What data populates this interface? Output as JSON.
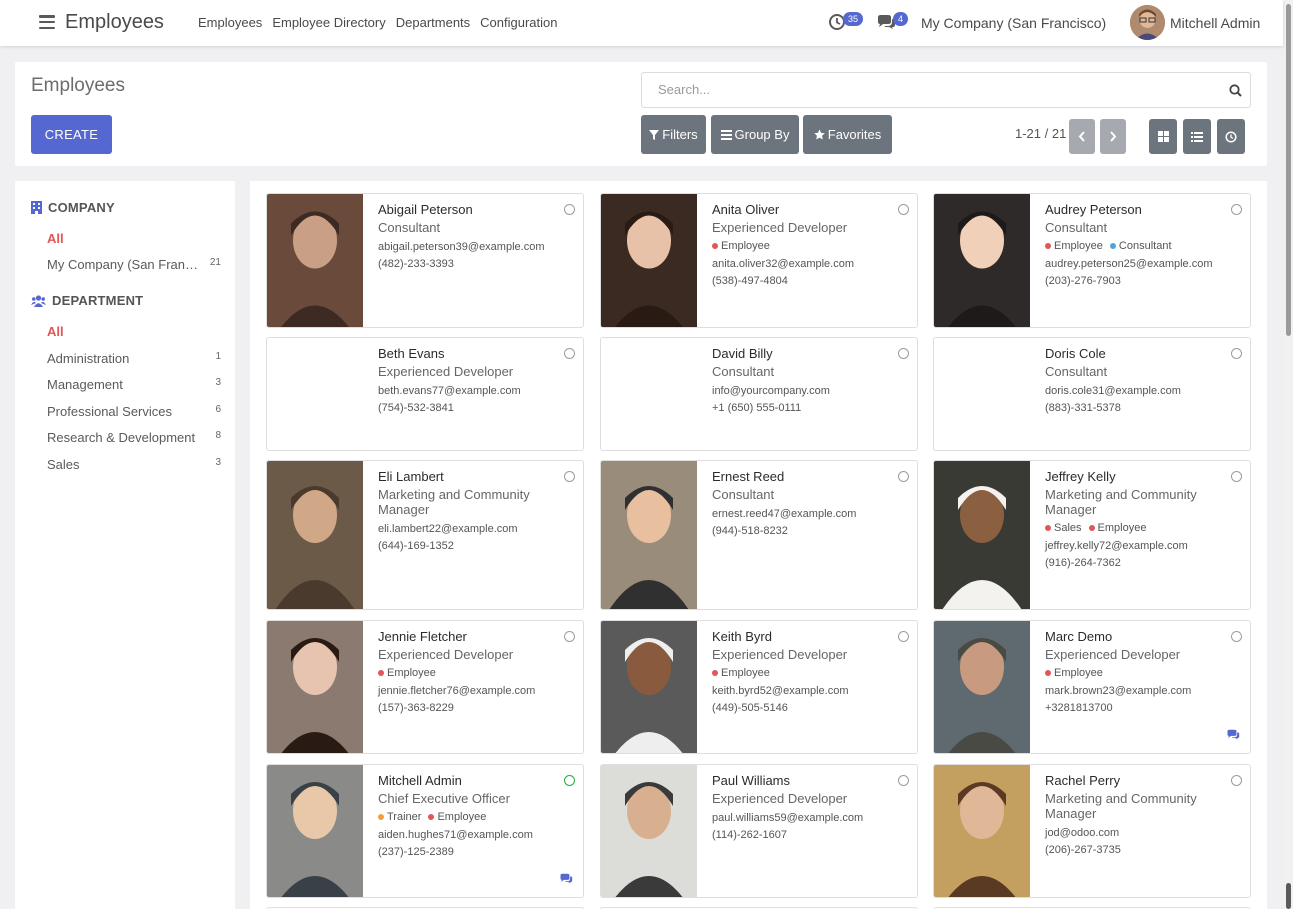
{
  "app": {
    "title": "Employees"
  },
  "menu": [
    "Employees",
    "Employee Directory",
    "Departments",
    "Configuration"
  ],
  "systray": {
    "activity_count": "35",
    "message_count": "4",
    "company": "My Company (San Francisco)",
    "user": "Mitchell Admin"
  },
  "control": {
    "breadcrumb": "Employees",
    "create_label": "CREATE",
    "search_placeholder": "Search...",
    "filters_label": "Filters",
    "groupby_label": "Group By",
    "favorites_label": "Favorites",
    "pager": "1-21 / 21"
  },
  "sidebar": {
    "company_header": "COMPANY",
    "company_items": [
      {
        "label": "All",
        "count": ""
      },
      {
        "label": "My Company (San Francisco)",
        "count": "21"
      }
    ],
    "department_header": "DEPARTMENT",
    "department_items": [
      {
        "label": "All",
        "count": ""
      },
      {
        "label": "Administration",
        "count": "1"
      },
      {
        "label": "Management",
        "count": "3"
      },
      {
        "label": "Professional Services",
        "count": "6"
      },
      {
        "label": "Research & Development",
        "count": "8"
      },
      {
        "label": "Sales",
        "count": "3"
      }
    ]
  },
  "colors": {
    "accent": "#5567d0",
    "tag_employee": "#e15656",
    "tag_consultant": "#4fa3e0",
    "tag_trainer": "#f0a040",
    "online": "#28a745"
  },
  "employees": [
    {
      "name": "Abigail Peterson",
      "job": "Consultant",
      "tags": [],
      "email": "abigail.peterson39@example.com",
      "phone": "(482)-233-3393",
      "online": false,
      "chat": false
    },
    {
      "name": "Anita Oliver",
      "job": "Experienced Developer",
      "tags": [
        {
          "label": "Employee",
          "color": "#e15656"
        }
      ],
      "email": "anita.oliver32@example.com",
      "phone": "(538)-497-4804",
      "online": false,
      "chat": false
    },
    {
      "name": "Audrey Peterson",
      "job": "Consultant",
      "tags": [
        {
          "label": "Employee",
          "color": "#e15656"
        },
        {
          "label": "Consultant",
          "color": "#4fa3e0"
        }
      ],
      "email": "audrey.peterson25@example.com",
      "phone": "(203)-276-7903",
      "online": false,
      "chat": false
    },
    {
      "name": "Beth Evans",
      "job": "Experienced Developer",
      "tags": [],
      "email": "beth.evans77@example.com",
      "phone": "(754)-532-3841",
      "online": false,
      "chat": false
    },
    {
      "name": "David Billy",
      "job": "Consultant",
      "tags": [],
      "email": "info@yourcompany.com",
      "phone": "+1 (650) 555-0111",
      "online": false,
      "chat": false
    },
    {
      "name": "Doris Cole",
      "job": "Consultant",
      "tags": [],
      "email": "doris.cole31@example.com",
      "phone": "(883)-331-5378",
      "online": false,
      "chat": false
    },
    {
      "name": "Eli Lambert",
      "job": "Marketing and Community Manager",
      "tags": [],
      "email": "eli.lambert22@example.com",
      "phone": "(644)-169-1352",
      "online": false,
      "chat": false
    },
    {
      "name": "Ernest Reed",
      "job": "Consultant",
      "tags": [],
      "email": "ernest.reed47@example.com",
      "phone": "(944)-518-8232",
      "online": false,
      "chat": false
    },
    {
      "name": "Jeffrey Kelly",
      "job": "Marketing and Community Manager",
      "tags": [
        {
          "label": "Sales",
          "color": "#e15656"
        },
        {
          "label": "Employee",
          "color": "#e15656"
        }
      ],
      "email": "jeffrey.kelly72@example.com",
      "phone": "(916)-264-7362",
      "online": false,
      "chat": false
    },
    {
      "name": "Jennie Fletcher",
      "job": "Experienced Developer",
      "tags": [
        {
          "label": "Employee",
          "color": "#e15656"
        }
      ],
      "email": "jennie.fletcher76@example.com",
      "phone": "(157)-363-8229",
      "online": false,
      "chat": false
    },
    {
      "name": "Keith Byrd",
      "job": "Experienced Developer",
      "tags": [
        {
          "label": "Employee",
          "color": "#e15656"
        }
      ],
      "email": "keith.byrd52@example.com",
      "phone": "(449)-505-5146",
      "online": false,
      "chat": false
    },
    {
      "name": "Marc Demo",
      "job": "Experienced Developer",
      "tags": [
        {
          "label": "Employee",
          "color": "#e15656"
        }
      ],
      "email": "mark.brown23@example.com",
      "phone": "+3281813700",
      "online": false,
      "chat": true
    },
    {
      "name": "Mitchell Admin",
      "job": "Chief Executive Officer",
      "tags": [
        {
          "label": "Trainer",
          "color": "#f0a040"
        },
        {
          "label": "Employee",
          "color": "#e15656"
        }
      ],
      "email": "aiden.hughes71@example.com",
      "phone": "(237)-125-2389",
      "online": true,
      "chat": true
    },
    {
      "name": "Paul Williams",
      "job": "Experienced Developer",
      "tags": [],
      "email": "paul.williams59@example.com",
      "phone": "(114)-262-1607",
      "online": false,
      "chat": false
    },
    {
      "name": "Rachel Perry",
      "job": "Marketing and Community Manager",
      "tags": [],
      "email": "jod@odoo.com",
      "phone": "(206)-267-3735",
      "online": false,
      "chat": false
    }
  ]
}
